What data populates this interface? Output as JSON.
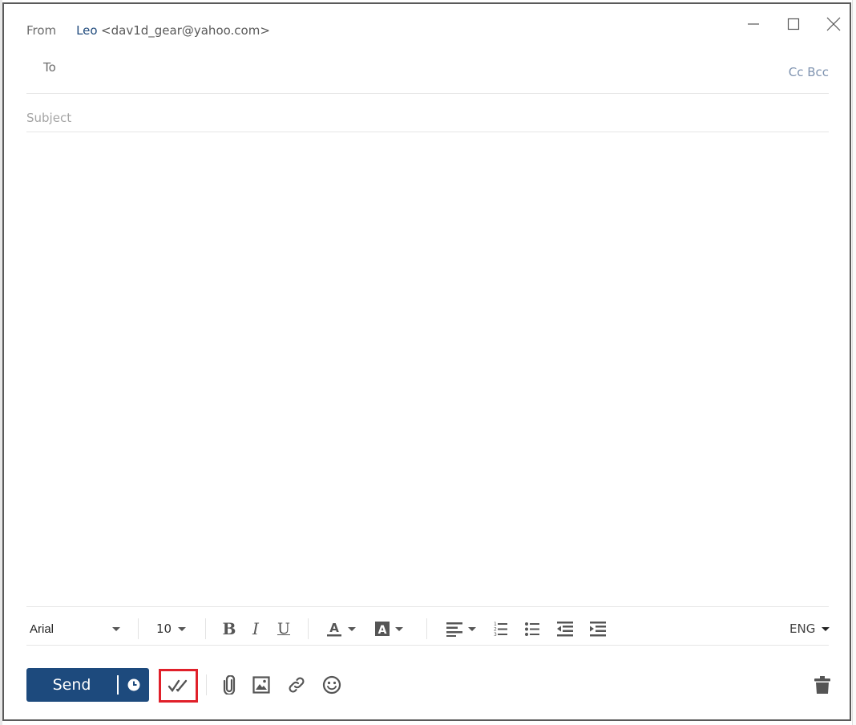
{
  "window": {
    "controls": [
      "minimize-icon",
      "maximize-icon",
      "close-icon"
    ]
  },
  "header": {
    "from_label": "From",
    "from_name": "Leo",
    "from_email": "<dav1d_gear@yahoo.com>",
    "to_label": "To",
    "to_value": "",
    "cc_bcc_label": "Cc Bcc",
    "subject_placeholder": "Subject",
    "subject_value": ""
  },
  "body": {
    "value": ""
  },
  "format_toolbar": {
    "font_family": "Arial",
    "font_size": "10",
    "bold_icon": "bold-icon",
    "italic_icon": "italic-icon",
    "underline_icon": "underline-icon",
    "text_color_icon": "text-color-icon",
    "highlight_icon": "highlight-color-icon",
    "align_icon": "align-left-icon",
    "numbered_list_icon": "numbered-list-icon",
    "bullet_list_icon": "bullet-list-icon",
    "outdent_icon": "outdent-icon",
    "indent_icon": "indent-icon",
    "language": "ENG"
  },
  "action_bar": {
    "send_label": "Send",
    "schedule_icon": "clock-icon",
    "read_receipt_icon": "double-check-icon",
    "attach_icon": "paperclip-icon",
    "image_icon": "image-icon",
    "link_icon": "link-icon",
    "emoji_icon": "smiley-icon",
    "delete_icon": "trash-icon"
  },
  "colors": {
    "accent": "#1d4a7d",
    "highlight_box": "#e0202a",
    "icon_gray": "#555555"
  }
}
